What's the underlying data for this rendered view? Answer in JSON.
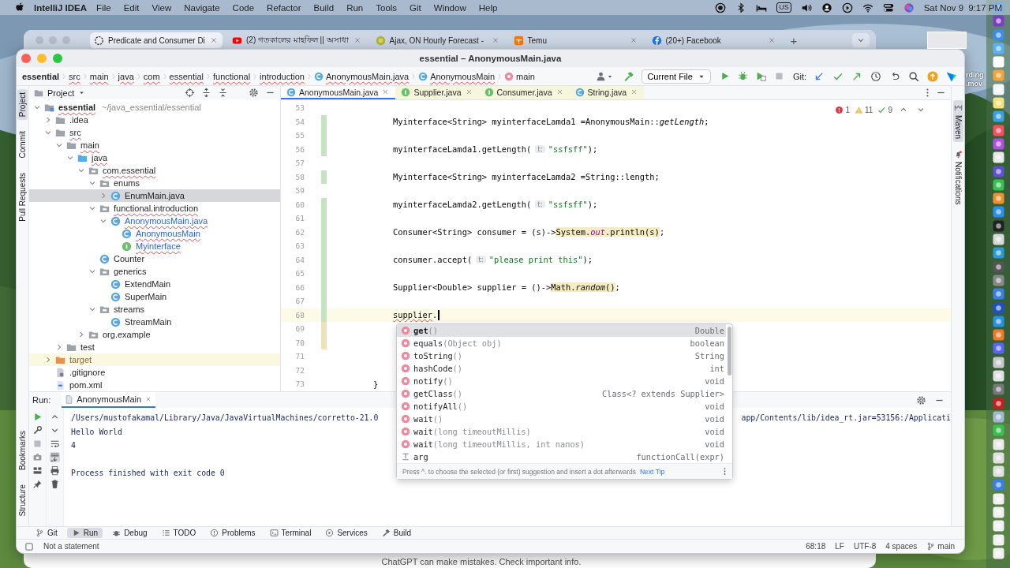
{
  "menu_bar": {
    "app": "IntelliJ IDEA",
    "menus": [
      "File",
      "Edit",
      "View",
      "Navigate",
      "Code",
      "Refactor",
      "Build",
      "Run",
      "Tools",
      "Git",
      "Window",
      "Help"
    ],
    "input_source": "US",
    "date": "Sat Nov 9",
    "time": "9:17 PM"
  },
  "browser": {
    "tabs": [
      {
        "title": "Predicate and Consumer Di",
        "selected": true
      },
      {
        "title": "(2) গতকালের মাহফিল || অসাধা",
        "selected": false
      },
      {
        "title": "Ajax, ON Hourly Forecast -",
        "selected": false
      },
      {
        "title": "Temu",
        "selected": false
      },
      {
        "title": "(20+) Facebook",
        "selected": false
      }
    ],
    "new_tab": "+",
    "footer": "ChatGPT can make mistakes. Check important info."
  },
  "desktop_file": {
    "label_lines": [
      "rding",
      ".mov"
    ]
  },
  "window": {
    "title": "essential – AnonymousMain.java"
  },
  "breadcrumbs": [
    {
      "label": "essential",
      "kind": "directory",
      "bold": true,
      "errors": false
    },
    {
      "label": "src",
      "kind": "directory",
      "bold": false,
      "errors": true
    },
    {
      "label": "main",
      "kind": "directory",
      "bold": false,
      "errors": true
    },
    {
      "label": "java",
      "kind": "directory",
      "bold": false,
      "errors": true
    },
    {
      "label": "com",
      "kind": "directory",
      "bold": false,
      "errors": true
    },
    {
      "label": "essential",
      "kind": "directory",
      "bold": false,
      "errors": true
    },
    {
      "label": "functional",
      "kind": "directory",
      "bold": false,
      "errors": true
    },
    {
      "label": "introduction",
      "kind": "directory",
      "bold": false,
      "errors": true
    },
    {
      "label": "AnonymousMain.java",
      "kind": "class",
      "bold": false,
      "errors": true
    },
    {
      "label": "AnonymousMain",
      "kind": "class",
      "bold": false,
      "errors": true
    },
    {
      "label": "main",
      "kind": "method",
      "bold": false,
      "errors": false
    }
  ],
  "toolbar": {
    "run_config": "Current File",
    "git_label": "Git:"
  },
  "left_tools": {
    "top": [
      {
        "label": "Project",
        "selected": true
      },
      {
        "label": "Commit",
        "selected": false
      },
      {
        "label": "Pull Requests",
        "selected": false
      }
    ],
    "bottom": [
      {
        "label": "Bookmarks",
        "selected": false
      },
      {
        "label": "Structure",
        "selected": false
      }
    ]
  },
  "right_tools": [
    {
      "label": "Maven",
      "selected": true
    },
    {
      "label": "Notifications",
      "selected": false
    }
  ],
  "project_panel": {
    "title": "Project",
    "tree": [
      {
        "name": "essential",
        "path": "~/java_essential/essential",
        "kind": "module",
        "expanded": true,
        "selected": false,
        "errors": true,
        "modified": false,
        "children": [
          {
            "name": ".idea",
            "kind": "folder",
            "expanded": false,
            "selected": false,
            "errors": false,
            "modified": false
          },
          {
            "name": "src",
            "kind": "folder",
            "expanded": true,
            "selected": false,
            "errors": true,
            "modified": false,
            "children": [
              {
                "name": "main",
                "kind": "folder",
                "expanded": true,
                "selected": false,
                "errors": true,
                "modified": false,
                "children": [
                  {
                    "name": "java",
                    "kind": "source-folder",
                    "expanded": true,
                    "selected": false,
                    "errors": true,
                    "modified": false,
                    "children": [
                      {
                        "name": "com.essential",
                        "kind": "package",
                        "expanded": true,
                        "selected": false,
                        "errors": true,
                        "modified": false,
                        "children": [
                          {
                            "name": "enums",
                            "kind": "package",
                            "expanded": true,
                            "selected": false,
                            "errors": false,
                            "modified": false,
                            "children": [
                              {
                                "name": "EnumMain.java",
                                "kind": "class",
                                "expanded": false,
                                "selected": true,
                                "errors": false,
                                "modified": false
                              }
                            ]
                          },
                          {
                            "name": "functional.introduction",
                            "kind": "package",
                            "expanded": true,
                            "selected": false,
                            "errors": true,
                            "modified": false,
                            "children": [
                              {
                                "name": "AnonymousMain.java",
                                "kind": "class",
                                "expanded": true,
                                "selected": false,
                                "errors": true,
                                "modified": true,
                                "children": [
                                  {
                                    "name": "AnonymousMain",
                                    "kind": "class",
                                    "selected": false,
                                    "errors": true,
                                    "modified": true
                                  },
                                  {
                                    "name": "Myinterface",
                                    "kind": "interface",
                                    "selected": false,
                                    "errors": true,
                                    "modified": true
                                  }
                                ]
                              }
                            ]
                          },
                          {
                            "name": "Counter",
                            "kind": "class",
                            "selected": false,
                            "errors": false,
                            "modified": false
                          },
                          {
                            "name": "generics",
                            "kind": "package",
                            "expanded": true,
                            "selected": false,
                            "errors": false,
                            "modified": false,
                            "children": [
                              {
                                "name": "ExtendMain",
                                "kind": "class",
                                "selected": false,
                                "errors": false,
                                "modified": false
                              },
                              {
                                "name": "SuperMain",
                                "kind": "class",
                                "selected": false,
                                "errors": false,
                                "modified": false
                              }
                            ]
                          },
                          {
                            "name": "streams",
                            "kind": "package",
                            "expanded": true,
                            "selected": false,
                            "errors": false,
                            "modified": false,
                            "children": [
                              {
                                "name": "StreamMain",
                                "kind": "class",
                                "selected": false,
                                "errors": false,
                                "modified": false
                              }
                            ]
                          }
                        ]
                      },
                      {
                        "name": "org.example",
                        "kind": "package",
                        "expanded": false,
                        "selected": false,
                        "errors": false,
                        "modified": false
                      }
                    ]
                  }
                ]
              },
              {
                "name": "test",
                "kind": "folder",
                "expanded": false,
                "selected": false,
                "errors": false,
                "modified": false
              }
            ]
          },
          {
            "name": "target",
            "kind": "excluded-folder",
            "expanded": false,
            "selected": false,
            "errors": false,
            "modified": false
          },
          {
            "name": ".gitignore",
            "kind": "gitignore",
            "selected": false,
            "errors": false,
            "modified": false
          },
          {
            "name": "pom.xml",
            "kind": "maven",
            "selected": false,
            "errors": false,
            "modified": false
          }
        ]
      }
    ]
  },
  "editor": {
    "tabs": [
      {
        "label": "AnonymousMain.java",
        "kind": "class",
        "selected": true
      },
      {
        "label": "Supplier.java",
        "kind": "interface",
        "selected": false
      },
      {
        "label": "Consumer.java",
        "kind": "interface",
        "selected": false
      },
      {
        "label": "String.java",
        "kind": "class",
        "selected": false
      }
    ],
    "inspections": [
      {
        "kind": "error",
        "count": "1"
      },
      {
        "kind": "warning",
        "count": "11"
      },
      {
        "kind": "weak",
        "count": "9"
      }
    ],
    "lines": [
      {
        "number": "53",
        "added": false,
        "modified": false,
        "current": false
      },
      {
        "number": "54",
        "added": true,
        "modified": false,
        "current": false,
        "tokens": [
          {
            "text": "        Myinterface<String> myinterfaceLamda1 =AnonymousMain::",
            "kind": "code"
          },
          {
            "text": "getLength",
            "kind": "italic"
          },
          {
            "text": ";",
            "kind": "code"
          }
        ]
      },
      {
        "number": "55",
        "added": true,
        "modified": false,
        "current": false
      },
      {
        "number": "56",
        "added": true,
        "modified": false,
        "current": false,
        "tokens": [
          {
            "text": "        myinterfaceLamda1.getLength(",
            "kind": "code"
          },
          {
            "text": "t:",
            "kind": "hint"
          },
          {
            "text": "\"ssfsff\"",
            "kind": "string"
          },
          {
            "text": ");",
            "kind": "code"
          }
        ]
      },
      {
        "number": "57",
        "added": false,
        "modified": false,
        "current": false
      },
      {
        "number": "58",
        "added": true,
        "modified": false,
        "current": false,
        "tokens": [
          {
            "text": "        Myinterface<String> myinterfaceLamda2 =String::length;",
            "kind": "code"
          }
        ]
      },
      {
        "number": "59",
        "added": false,
        "modified": false,
        "current": false
      },
      {
        "number": "60",
        "added": true,
        "modified": false,
        "current": false,
        "tokens": [
          {
            "text": "        myinterfaceLamda2.getLength(",
            "kind": "code"
          },
          {
            "text": "t:",
            "kind": "hint"
          },
          {
            "text": "\"ssfsff\"",
            "kind": "string"
          },
          {
            "text": ");",
            "kind": "code"
          }
        ]
      },
      {
        "number": "61",
        "added": true,
        "modified": false,
        "current": false
      },
      {
        "number": "62",
        "added": true,
        "modified": false,
        "current": false,
        "tokens": [
          {
            "text": "        Consumer<String> consumer = (s)->",
            "kind": "code"
          },
          {
            "text": "System.",
            "kind": "mark"
          },
          {
            "text": "out",
            "kind": "mark-field"
          },
          {
            "text": ".println(s)",
            "kind": "mark"
          },
          {
            "text": ";",
            "kind": "code"
          }
        ]
      },
      {
        "number": "63",
        "added": true,
        "modified": false,
        "current": false
      },
      {
        "number": "64",
        "added": true,
        "modified": false,
        "current": false,
        "tokens": [
          {
            "text": "        consumer.accept(",
            "kind": "code"
          },
          {
            "text": "t:",
            "kind": "hint"
          },
          {
            "text": "\"please print this\"",
            "kind": "string"
          },
          {
            "text": ");",
            "kind": "code"
          }
        ]
      },
      {
        "number": "65",
        "added": true,
        "modified": false,
        "current": false
      },
      {
        "number": "66",
        "added": true,
        "modified": false,
        "current": false,
        "tokens": [
          {
            "text": "        Supplier<Double> supplier = ()->",
            "kind": "code"
          },
          {
            "text": "Math.",
            "kind": "mark"
          },
          {
            "text": "random",
            "kind": "mark-italic"
          },
          {
            "text": "()",
            "kind": "mark"
          },
          {
            "text": ";",
            "kind": "code"
          }
        ]
      },
      {
        "number": "67",
        "added": true,
        "modified": false,
        "current": false
      },
      {
        "number": "68",
        "added": true,
        "modified": false,
        "current": true,
        "tokens": [
          {
            "text": "        supplier",
            "kind": "error"
          },
          {
            "text": ".",
            "kind": "code"
          }
        ]
      },
      {
        "number": "69",
        "added": false,
        "modified": true,
        "current": false
      },
      {
        "number": "70",
        "added": false,
        "modified": true,
        "current": false
      },
      {
        "number": "71",
        "added": false,
        "modified": false,
        "current": false
      },
      {
        "number": "72",
        "added": false,
        "modified": false,
        "current": false
      },
      {
        "number": "73",
        "added": false,
        "modified": false,
        "current": false,
        "tokens": [
          {
            "text": "    }",
            "kind": "code"
          }
        ]
      }
    ]
  },
  "completion": {
    "items": [
      {
        "name": "get",
        "params": "()",
        "type": "Double",
        "kind": "method",
        "selected": true
      },
      {
        "name": "equals",
        "params": "(Object obj)",
        "type": "boolean",
        "kind": "method",
        "selected": false
      },
      {
        "name": "toString",
        "params": "()",
        "type": "String",
        "kind": "method",
        "selected": false
      },
      {
        "name": "hashCode",
        "params": "()",
        "type": "int",
        "kind": "method",
        "selected": false
      },
      {
        "name": "notify",
        "params": "()",
        "type": "void",
        "kind": "method",
        "selected": false
      },
      {
        "name": "getClass",
        "params": "()",
        "type": "Class<? extends Supplier>",
        "kind": "method",
        "selected": false
      },
      {
        "name": "notifyAll",
        "params": "()",
        "type": "void",
        "kind": "method",
        "selected": false
      },
      {
        "name": "wait",
        "params": "()",
        "type": "void",
        "kind": "method",
        "selected": false
      },
      {
        "name": "wait",
        "params": "(long timeoutMillis)",
        "type": "void",
        "kind": "method",
        "selected": false
      },
      {
        "name": "wait",
        "params": "(long timeoutMillis, int nanos)",
        "type": "void",
        "kind": "method",
        "selected": false
      },
      {
        "name": "arg",
        "type": "functionCall(expr)",
        "kind": "template",
        "selected": false
      }
    ],
    "hint": "Press ^. to choose the selected (or first) suggestion and insert a dot afterwards",
    "next_tip": "Next Tip"
  },
  "run_panel": {
    "label": "Run:",
    "tab": "AnonymousMain",
    "output": [
      {
        "text": "/Users/mustofakamal/Library/Java/JavaVirtualMachines/corretto-21.0",
        "tail": "app/Contents/lib/idea_rt.jar=53156:/Applicati",
        "kind": "command"
      },
      {
        "text": "Hello World",
        "kind": "stdout"
      },
      {
        "text": "4",
        "kind": "stdout"
      },
      {
        "text": "Process finished with exit code 0",
        "kind": "exit"
      }
    ]
  },
  "tool_windows": [
    {
      "label": "Git",
      "selected": false
    },
    {
      "label": "Run",
      "selected": true
    },
    {
      "label": "Debug",
      "selected": false
    },
    {
      "label": "TODO",
      "selected": false
    },
    {
      "label": "Problems",
      "selected": false
    },
    {
      "label": "Terminal",
      "selected": false
    },
    {
      "label": "Services",
      "selected": false
    },
    {
      "label": "Build",
      "selected": false
    }
  ],
  "status_bar": {
    "message": "Not a statement",
    "position": "68:18",
    "line_separator": "LF",
    "encoding": "UTF-8",
    "indent": "4 spaces",
    "branch": "main"
  }
}
